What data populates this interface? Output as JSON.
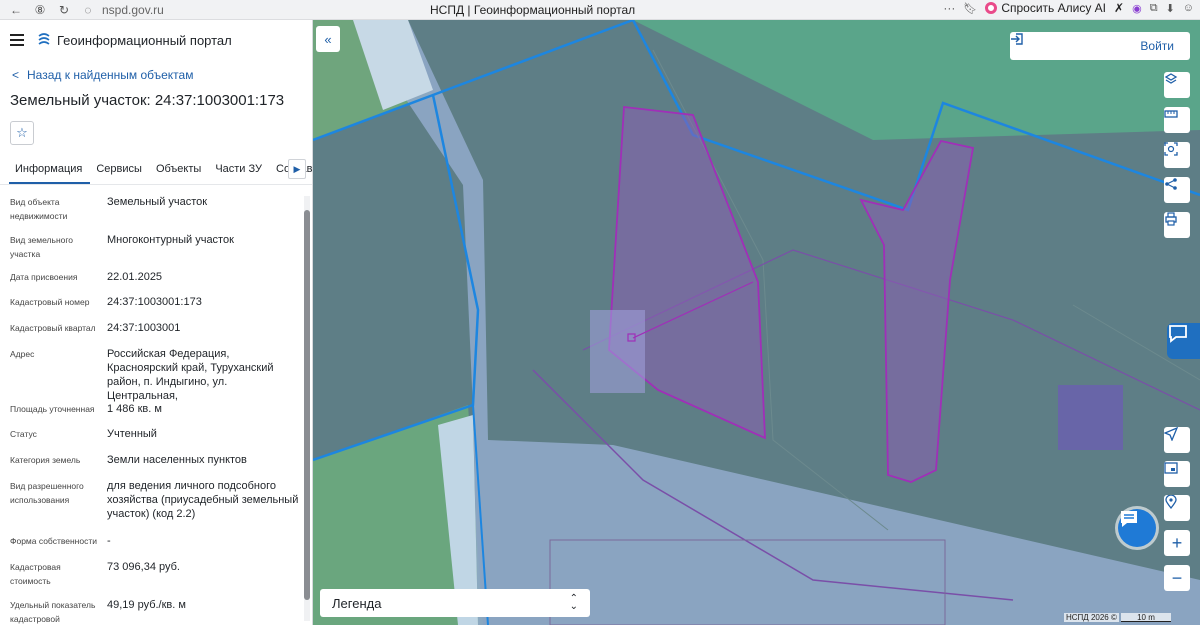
{
  "browser": {
    "url": "nspd.gov.ru",
    "tab_title": "НСПД | Геоинформационный портал",
    "alice_label": "Спросить Алису AI"
  },
  "app": {
    "title": "Геоинформационный портал",
    "back_label": "Назад к найденным объектам",
    "object_title": "Земельный участок: 24:37:1003001:173"
  },
  "tabs": [
    "Информация",
    "Сервисы",
    "Объекты",
    "Части ЗУ",
    "Состав"
  ],
  "properties": [
    {
      "label": "Вид объекта недвижимости",
      "value": "Земельный участок"
    },
    {
      "label": "Вид земельного участка",
      "value": "Многоконтурный участок"
    },
    {
      "label": "Дата присвоения",
      "value": "22.01.2025"
    },
    {
      "label": "Кадастровый номер",
      "value": "24:37:1003001:173"
    },
    {
      "label": "Кадастровый квартал",
      "value": "24:37:1003001"
    },
    {
      "label": "Адрес",
      "value": "Российская Федерация, Красноярский край, Туруханский район, п. Индыгино, ул. Центральная,"
    },
    {
      "label": "Площадь уточненная",
      "value": "1 486 кв. м"
    },
    {
      "label": "Статус",
      "value": "Учтенный"
    },
    {
      "label": "Категория земель",
      "value": "Земли населенных пунктов"
    },
    {
      "label": "Вид разрешенного использования",
      "value": "для ведения личного подсобного хозяйства (приусадебный земельный участок) (код 2.2)"
    },
    {
      "label": "Форма собственности",
      "value": "-"
    },
    {
      "label": "Кадастровая стоимость",
      "value": "73 096,34 руб."
    },
    {
      "label": "Удельный показатель кадастровой",
      "value": "49,19 руб./кв. м"
    }
  ],
  "map": {
    "login_label": "Войти",
    "legend_label": "Легенда",
    "attribution": "НСПД 2026 ©",
    "scale_label": "10 m"
  }
}
